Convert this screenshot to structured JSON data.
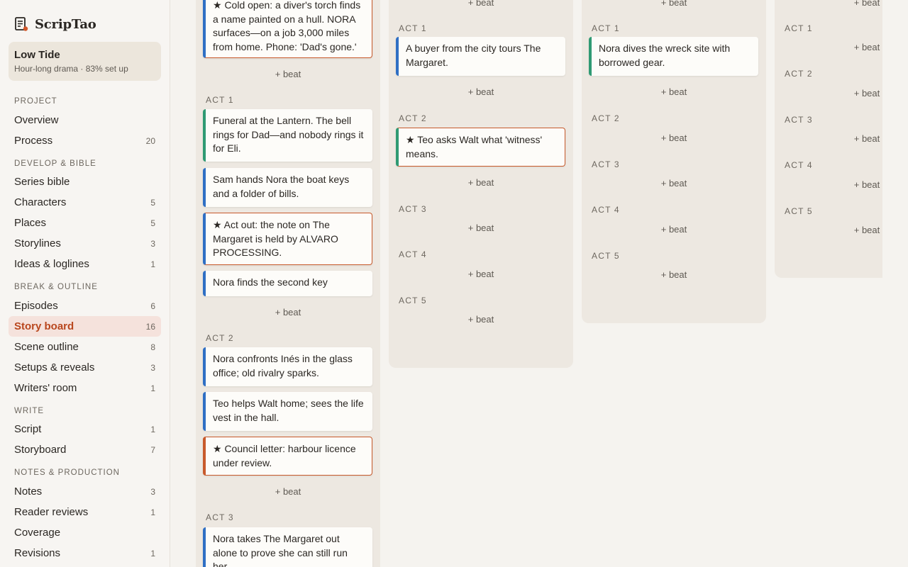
{
  "app": {
    "name": "ScripTao"
  },
  "project": {
    "title": "Low Tide",
    "subtitle": "Hour-long drama · 83% set up"
  },
  "sidebar": {
    "sections": [
      "Project",
      "Develop & bible",
      "Break & outline",
      "Write",
      "Notes & production"
    ],
    "items": [
      {
        "label": "Overview",
        "count": ""
      },
      {
        "label": "Process",
        "count": "20"
      },
      {
        "label": "Series bible",
        "count": ""
      },
      {
        "label": "Characters",
        "count": "5"
      },
      {
        "label": "Places",
        "count": "5"
      },
      {
        "label": "Storylines",
        "count": "3"
      },
      {
        "label": "Ideas & loglines",
        "count": "1"
      },
      {
        "label": "Episodes",
        "count": "6"
      },
      {
        "label": "Story board",
        "count": "16"
      },
      {
        "label": "Scene outline",
        "count": "8"
      },
      {
        "label": "Setups & reveals",
        "count": "3"
      },
      {
        "label": "Writers' room",
        "count": "1"
      },
      {
        "label": "Script",
        "count": "1"
      },
      {
        "label": "Storyboard",
        "count": "7"
      },
      {
        "label": "Notes",
        "count": "3"
      },
      {
        "label": "Reader reviews",
        "count": "1"
      },
      {
        "label": "Coverage",
        "count": ""
      },
      {
        "label": "Revisions",
        "count": "1"
      }
    ]
  },
  "board": {
    "add_beat_label": "+ beat",
    "acts": [
      "Act 1",
      "Act 2",
      "Act 3",
      "Act 4",
      "Act 5"
    ],
    "columns": [
      {
        "cold_open": "★ Cold open: a diver's torch finds a name painted on a hull. NORA surfaces—on a job 3,000 miles from home. Phone: 'Dad's gone.'",
        "act1": [
          "Funeral at the Lantern. The bell rings for Dad—and nobody rings it for Eli.",
          "Sam hands Nora the boat keys and a folder of bills.",
          "★ Act out: the note on The Margaret is held by ALVARO PROCESSING.",
          "Nora finds the second key"
        ],
        "act2": [
          "Nora confronts Inés in the glass office; old rivalry sparks.",
          "Teo helps Walt home; sees the life vest in the hall.",
          "★ Council letter: harbour licence under review."
        ],
        "act3": [
          "Nora takes The Margaret out alone to prove she can still run her."
        ]
      },
      {
        "act1": [
          "A buyer from the city tours The Margaret."
        ],
        "act2": [
          "★ Teo asks Walt what 'witness' means."
        ]
      },
      {
        "act1": [
          "Nora dives the wreck site with borrowed gear."
        ]
      }
    ]
  },
  "colors": {
    "accent": "#b9471e",
    "blue": "#2f6fc4",
    "green": "#2f9a73",
    "flag": "#c85a2c"
  }
}
